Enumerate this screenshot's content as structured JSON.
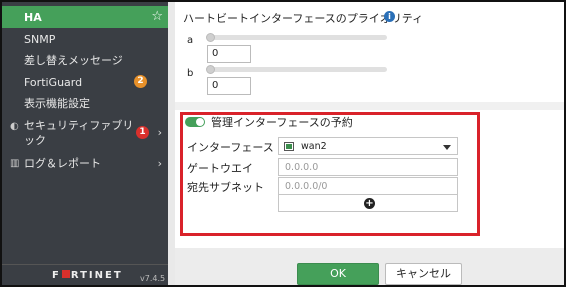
{
  "sidebar": {
    "items": [
      {
        "label": "HA",
        "active": true
      },
      {
        "label": "SNMP"
      },
      {
        "label": "差し替えメッセージ"
      },
      {
        "label": "FortiGuard",
        "badge": "2"
      },
      {
        "label": "表示機能設定"
      },
      {
        "label": "セキュリティファブリック",
        "badge": "1"
      },
      {
        "label": "ログ＆レポート"
      }
    ],
    "logo": "F■RTINET",
    "version": "v7.4.5"
  },
  "main": {
    "priority_title": "ハートビートインターフェースのプライオリティ",
    "sliders": [
      {
        "label": "a",
        "value": "0"
      },
      {
        "label": "b",
        "value": "0"
      }
    ],
    "reserve_title": "管理インターフェースの予約",
    "interface_label": "インターフェース",
    "interface_value": "wan2",
    "gateway_label": "ゲートウエイ",
    "gateway_placeholder": "0.0.0.0",
    "subnet_label": "宛先サブネット",
    "subnet_placeholder": "0.0.0.0/0"
  },
  "footer": {
    "ok_label": "OK",
    "cancel_label": "キャンセル"
  },
  "colors": {
    "accent": "#45a05a",
    "highlight": "#d9222a",
    "sidebar_bg": "#3a3e44"
  }
}
